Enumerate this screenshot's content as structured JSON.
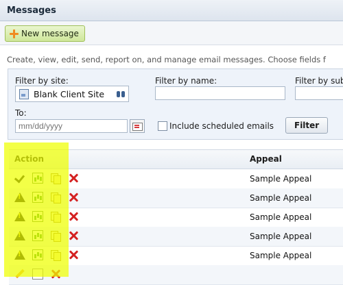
{
  "window": {
    "title": "Messages"
  },
  "toolbar": {
    "new_message_label": "New message"
  },
  "description": "Create, view, edit, send, report on, and manage email messages. Choose fields f",
  "filters": {
    "site_label": "Filter by site:",
    "site_value": "Blank Client Site",
    "name_label": "Filter by name:",
    "name_value": "",
    "subject_label": "Filter by sub",
    "to_label": "To:",
    "to_placeholder": "mm/dd/yyyy",
    "include_scheduled_label": "Include scheduled emails",
    "include_scheduled_checked": false,
    "filter_button": "Filter"
  },
  "grid": {
    "columns": [
      "Action",
      "Appeal"
    ],
    "rows": [
      {
        "status_icon": "check-icon",
        "appeal": "Sample Appeal"
      },
      {
        "status_icon": "warning-icon",
        "appeal": "Sample Appeal"
      },
      {
        "status_icon": "warning-icon",
        "appeal": "Sample Appeal"
      },
      {
        "status_icon": "warning-icon",
        "appeal": "Sample Appeal"
      },
      {
        "status_icon": "warning-icon",
        "appeal": "Sample Appeal"
      },
      {
        "status_icon": "pencil-icon",
        "appeal": ""
      }
    ]
  },
  "highlight_color": "#eeff00"
}
